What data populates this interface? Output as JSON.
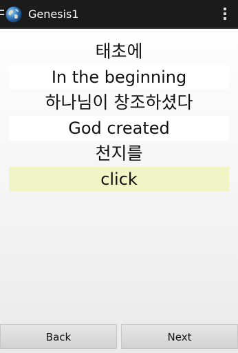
{
  "action_bar": {
    "title": "Genesis1",
    "app_icon": "globe-icon",
    "menu_icon": "overflow-menu-icon"
  },
  "lines": [
    {
      "korean": "태초에",
      "english": "In the beginning"
    },
    {
      "korean": "하나님이 창조하셨다",
      "english": "God created"
    },
    {
      "korean": "천지를",
      "english": "click"
    }
  ],
  "buttons": {
    "back": "Back",
    "next": "Next"
  },
  "colors": {
    "action_bar_bg": "#1b1b1b",
    "highlight_bg": "#f1f5c5",
    "answer_bg": "#ffffff"
  }
}
